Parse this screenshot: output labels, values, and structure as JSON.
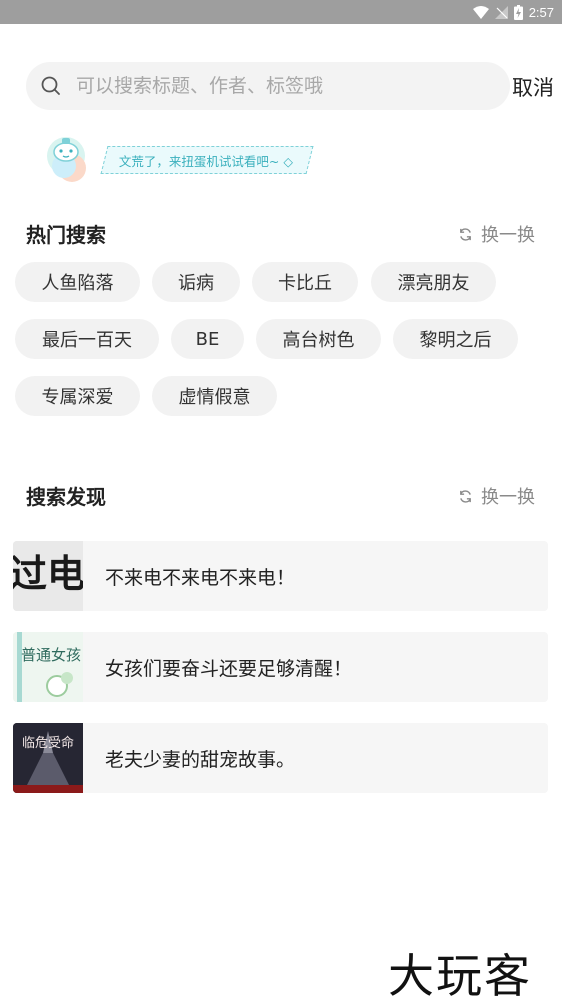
{
  "status_bar": {
    "time": "2:57"
  },
  "search": {
    "placeholder": "可以搜索标题、作者、标签哦",
    "value": "",
    "cancel_label": "取消"
  },
  "banner": {
    "text": "文荒了，来扭蛋机试试看吧~ ◇"
  },
  "hot_search": {
    "title": "热门搜索",
    "refresh_label": "换一换",
    "tags": [
      "人鱼陷落",
      "诟病",
      "卡比丘",
      "漂亮朋友",
      "最后一百天",
      "BE",
      "高台树色",
      "黎明之后",
      "专属深爱",
      "虚情假意"
    ]
  },
  "discover": {
    "title": "搜索发现",
    "refresh_label": "换一换",
    "items": [
      {
        "text": "不来电不来电不来电！",
        "cover_text": "过电"
      },
      {
        "text": "女孩们要奋斗还要足够清醒！",
        "cover_text": "普通女孩"
      },
      {
        "text": "老夫少妻的甜宠故事。",
        "cover_text": "临危受命"
      }
    ]
  },
  "watermark": "大玩客",
  "colors": {
    "status_bar": "#9e9e9e",
    "search_bg": "#f3f3f3",
    "tag_bg": "#f2f2f2",
    "accent_teal": "#3ab0bd"
  }
}
